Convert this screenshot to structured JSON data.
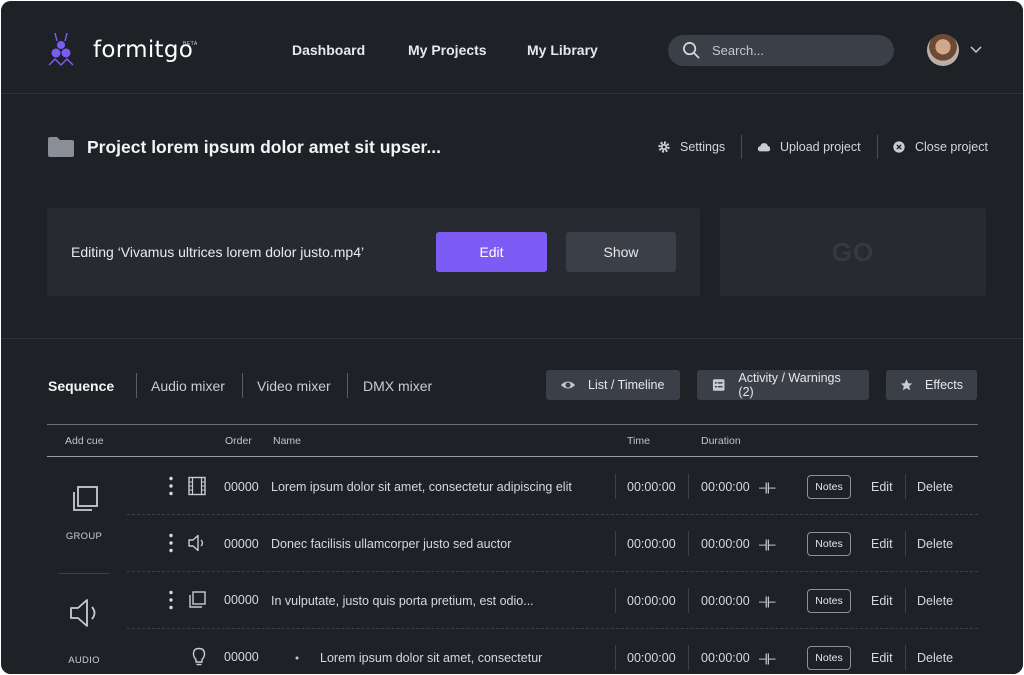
{
  "app": {
    "brand": "formitgo",
    "beta": "BETA"
  },
  "nav": {
    "dashboard": "Dashboard",
    "projects": "My Projects",
    "library": "My Library"
  },
  "search": {
    "placeholder": "Search..."
  },
  "project": {
    "title": "Project lorem ipsum dolor amet sit upser...",
    "settings": "Settings",
    "upload": "Upload project",
    "close": "Close project"
  },
  "editing": {
    "label": "Editing ‘Vivamus ultrices lorem dolor justo.mp4’",
    "edit_button": "Edit",
    "show_button": "Show",
    "go_label": "GO"
  },
  "tabs": {
    "sequence": "Sequence",
    "audio_mixer": "Audio mixer",
    "video_mixer": "Video mixer",
    "dmx_mixer": "DMX mixer"
  },
  "actions": {
    "list_timeline": "List / Timeline",
    "activity": "Activity / Warnings (2)",
    "effects": "Effects"
  },
  "table": {
    "headers": {
      "add_cue": "Add cue",
      "order": "Order",
      "name": "Name",
      "time": "Time",
      "duration": "Duration"
    },
    "groups": {
      "group": "GROUP",
      "audio": "AUDIO"
    },
    "rows": [
      {
        "icon": "film-icon",
        "order": "00000",
        "name": "Lorem ipsum dolor sit amet, consectetur adipiscing elit",
        "time": "00:00:00",
        "duration": "00:00:00",
        "marker": "–||–",
        "notes": "Notes",
        "edit": "Edit",
        "delete": "Delete"
      },
      {
        "icon": "speaker-icon",
        "order": "00000",
        "name": "Donec facilisis ullamcorper justo sed auctor",
        "time": "00:00:00",
        "duration": "00:00:00",
        "marker": "–||–",
        "notes": "Notes",
        "edit": "Edit",
        "delete": "Delete"
      },
      {
        "icon": "copy-icon",
        "order": "00000",
        "name": "In vulputate, justo quis porta pretium, est odio...",
        "time": "00:00:00",
        "duration": "00:00:00",
        "marker": "–||–",
        "notes": "Notes",
        "edit": "Edit",
        "delete": "Delete"
      },
      {
        "icon": "lightbulb-icon",
        "order": "00000",
        "name": "Lorem ipsum dolor sit amet, consectetur",
        "time": "00:00:00",
        "duration": "00:00:00",
        "marker": "–||–",
        "notes": "Notes",
        "edit": "Edit",
        "delete": "Delete"
      }
    ]
  },
  "colors": {
    "background": "#1e2126",
    "card": "#272b31",
    "accent": "#7c5cf5",
    "button": "#3b4048"
  }
}
